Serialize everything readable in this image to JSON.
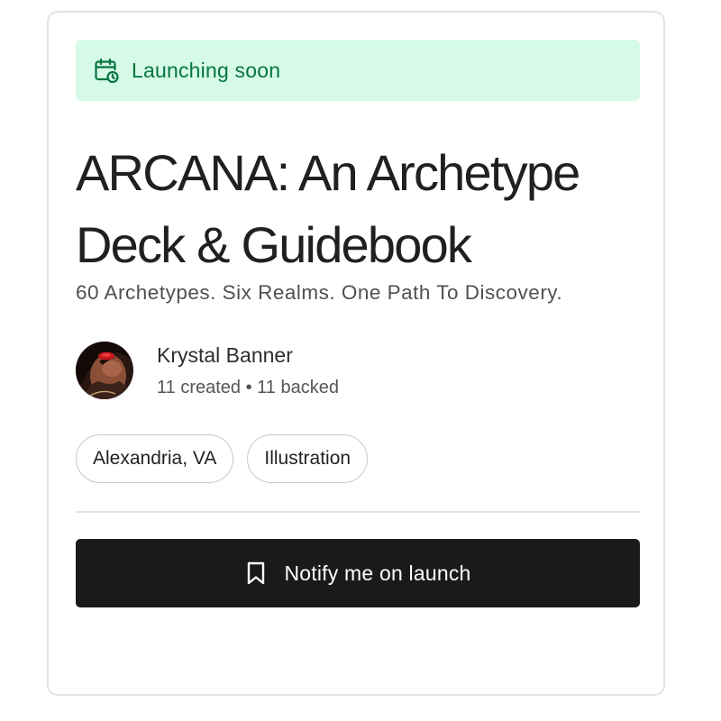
{
  "banner": {
    "icon": "calendar-clock-icon",
    "text": "Launching soon",
    "background": "#d6fae8",
    "color": "#05753f"
  },
  "project": {
    "title": "ARCANA: An Archetype Deck & Guidebook",
    "subtitle": "60 Archetypes. Six Realms. One Path To Discovery."
  },
  "creator": {
    "name": "Krystal Banner",
    "stats": "11 created • 11 backed"
  },
  "tags": [
    "Alexandria, VA",
    "Illustration"
  ],
  "action": {
    "icon": "bookmark-icon",
    "label": "Notify me on launch",
    "background": "#1a1a1a"
  }
}
